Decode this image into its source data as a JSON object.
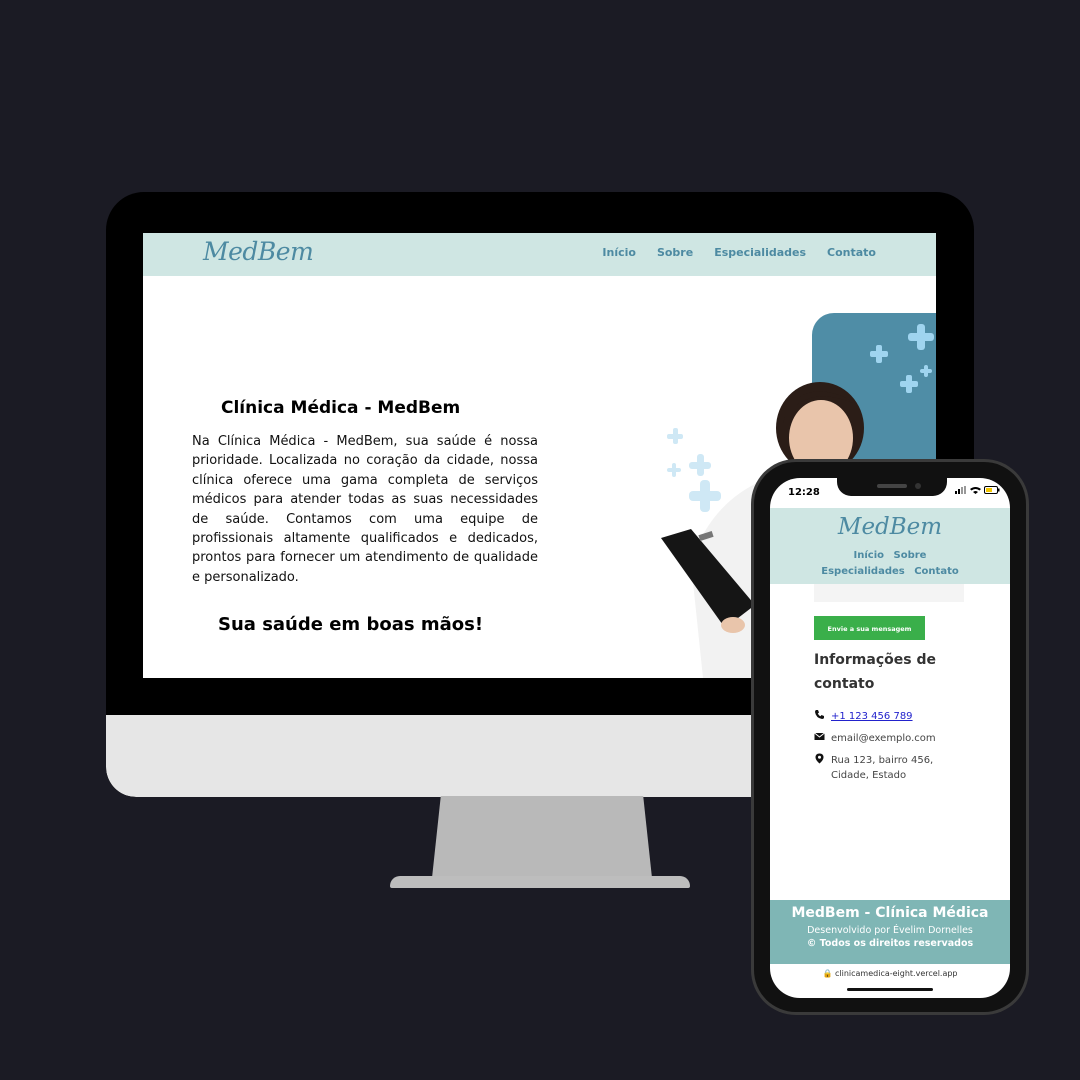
{
  "desktop": {
    "logo": "MedBem",
    "nav": [
      "Início",
      "Sobre",
      "Especialidades",
      "Contato"
    ],
    "title": "Clínica Médica - MedBem",
    "body": "Na Clínica Médica - MedBem, sua saúde é nossa prioridade. Localizada no coração da cidade, nossa clínica oferece uma gama completa de serviços médicos para atender todas as suas necessidades de saúde. Contamos com uma equipe de profissionais altamente qualificados e dedicados, prontos para fornecer um atendimento de qualidade e personalizado.",
    "slogan": "Sua saúde em boas mãos!"
  },
  "mobile": {
    "time": "12:28",
    "logo": "MedBem",
    "nav": [
      "Início",
      "Sobre",
      "Especialidades",
      "Contato"
    ],
    "send_button": "Envie a sua mensagem",
    "info_title": "Informações de contato",
    "phone": "+1 123 456 789",
    "email": "email@exemplo.com",
    "address": "Rua 123, bairro 456, Cidade, Estado",
    "footer_title": "MedBem - Clínica Médica",
    "footer_credit": "Desenvolvido por Évelim Dornelles",
    "footer_rights": "© Todos os direitos reservados",
    "url": "clinicamedica-eight.vercel.app"
  },
  "colors": {
    "nav_bg": "#cfe6e3",
    "brand_blue": "#4d8aa2",
    "hero_card": "#4f8da6",
    "send_green": "#3aaf4a",
    "footer_teal": "#7fb6b5",
    "page_bg": "#1b1b24"
  }
}
